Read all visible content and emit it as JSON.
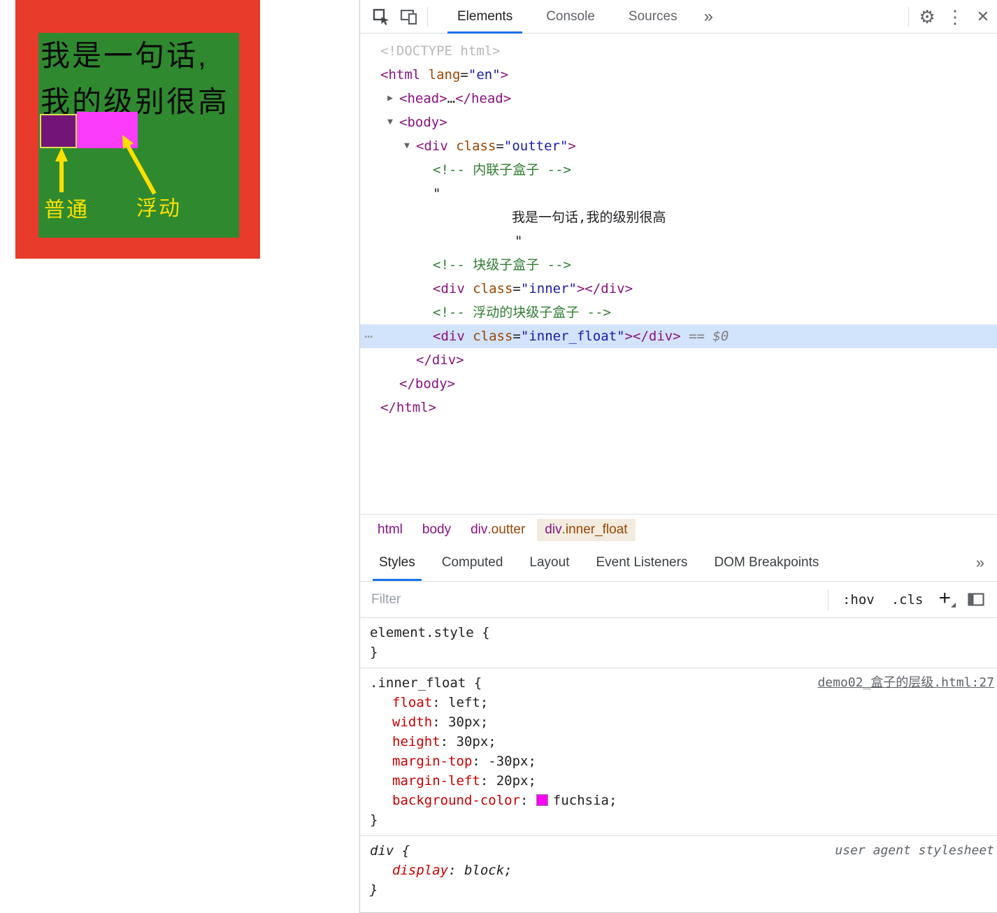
{
  "page": {
    "sentence_line1": "我是一句话,",
    "sentence_line2": "我的级别很高",
    "label_normal": "普通",
    "label_float": "浮动",
    "colors": {
      "red": "#e93b2c",
      "green": "#2f8a2f",
      "purple": "#731578",
      "fuchsia": "#fb3dfb",
      "yellow": "#ffe000"
    }
  },
  "devtools": {
    "toolbar": {
      "tabs": [
        {
          "label": "Elements",
          "active": true
        },
        {
          "label": "Console",
          "active": false
        },
        {
          "label": "Sources",
          "active": false
        }
      ],
      "more_tabs": "»"
    },
    "tree": {
      "lines": [
        {
          "i": 29,
          "tok": [
            [
              "doctype",
              "<!DOCTYPE html>"
            ]
          ]
        },
        {
          "i": 29,
          "tok": [
            [
              "tag",
              "<html"
            ],
            [
              "plain",
              " "
            ],
            [
              "attr",
              "lang"
            ],
            [
              "plain",
              "="
            ],
            [
              "str",
              "\"en\""
            ],
            [
              "tag",
              ">"
            ]
          ]
        },
        {
          "i": 56,
          "a": "r",
          "tok": [
            [
              "tag",
              "<head>"
            ],
            [
              "plain",
              "…"
            ],
            [
              "tag",
              "</head>"
            ]
          ]
        },
        {
          "i": 56,
          "a": "d",
          "tok": [
            [
              "tag",
              "<body>"
            ]
          ]
        },
        {
          "i": 80,
          "a": "d",
          "tok": [
            [
              "tag",
              "<div"
            ],
            [
              "plain",
              " "
            ],
            [
              "attr",
              "class"
            ],
            [
              "plain",
              "="
            ],
            [
              "str",
              "\"outter\""
            ],
            [
              "tag",
              ">"
            ]
          ]
        },
        {
          "i": 104,
          "tok": [
            [
              "comment",
              "<!-- 内联子盒子 -->"
            ]
          ]
        },
        {
          "i": 104,
          "tok": [
            [
              "plain",
              "\""
            ]
          ]
        },
        {
          "i": 217,
          "tok": [
            [
              "text",
              "我是一句话,我的级别很高"
            ]
          ]
        },
        {
          "i": 221,
          "tok": [
            [
              "plain",
              "\""
            ]
          ]
        },
        {
          "i": 104,
          "tok": [
            [
              "comment",
              "<!-- 块级子盒子 -->"
            ]
          ]
        },
        {
          "i": 104,
          "tok": [
            [
              "tag",
              "<div"
            ],
            [
              "plain",
              " "
            ],
            [
              "attr",
              "class"
            ],
            [
              "plain",
              "="
            ],
            [
              "str",
              "\"inner\""
            ],
            [
              "tag",
              "></div>"
            ]
          ]
        },
        {
          "i": 104,
          "tok": [
            [
              "comment",
              "<!-- 浮动的块级子盒子 -->"
            ]
          ]
        },
        {
          "i": 104,
          "hl": true,
          "dots": true,
          "tok": [
            [
              "tag",
              "<div"
            ],
            [
              "plain",
              " "
            ],
            [
              "attr",
              "class"
            ],
            [
              "plain",
              "="
            ],
            [
              "str",
              "\"inner_float\""
            ],
            [
              "tag",
              "></div>"
            ],
            [
              "flag",
              " == $0"
            ]
          ]
        },
        {
          "i": 80,
          "tok": [
            [
              "tag",
              "</div>"
            ]
          ]
        },
        {
          "i": 56,
          "tok": [
            [
              "tag",
              "</body>"
            ]
          ]
        },
        {
          "i": 29,
          "tok": [
            [
              "tag",
              "</html>"
            ]
          ]
        }
      ]
    },
    "breadcrumbs": [
      {
        "tag": "html",
        "cls": "",
        "selected": false
      },
      {
        "tag": "body",
        "cls": "",
        "selected": false
      },
      {
        "tag": "div",
        "cls": ".outter",
        "selected": false
      },
      {
        "tag": "div",
        "cls": ".inner_float",
        "selected": true
      }
    ],
    "sidebar_tabs": [
      {
        "label": "Styles",
        "active": true
      },
      {
        "label": "Computed",
        "active": false
      },
      {
        "label": "Layout",
        "active": false
      },
      {
        "label": "Event Listeners",
        "active": false
      },
      {
        "label": "DOM Breakpoints",
        "active": false
      }
    ],
    "sidebar_more": "»",
    "filter": {
      "placeholder": "Filter",
      "hov": ":hov",
      "cls": ".cls",
      "add": "+"
    },
    "styles": {
      "rules": [
        {
          "selector": "element.style",
          "ua": false,
          "link": null,
          "props": []
        },
        {
          "selector": ".inner_float",
          "ua": false,
          "link": {
            "text": "demo02_盒子的层级.html:27",
            "underline": true
          },
          "props": [
            {
              "n": "float",
              "v": "left"
            },
            {
              "n": "width",
              "v": "30px"
            },
            {
              "n": "height",
              "v": "30px"
            },
            {
              "n": "margin-top",
              "v": "-30px"
            },
            {
              "n": "margin-left",
              "v": "20px"
            },
            {
              "n": "background-color",
              "v": "fuchsia",
              "swatch": "#ff00ff"
            }
          ]
        },
        {
          "selector": "div",
          "ua": true,
          "link": {
            "text": "user agent stylesheet",
            "underline": false
          },
          "props": [
            {
              "n": "display",
              "v": "block"
            }
          ]
        }
      ]
    }
  }
}
